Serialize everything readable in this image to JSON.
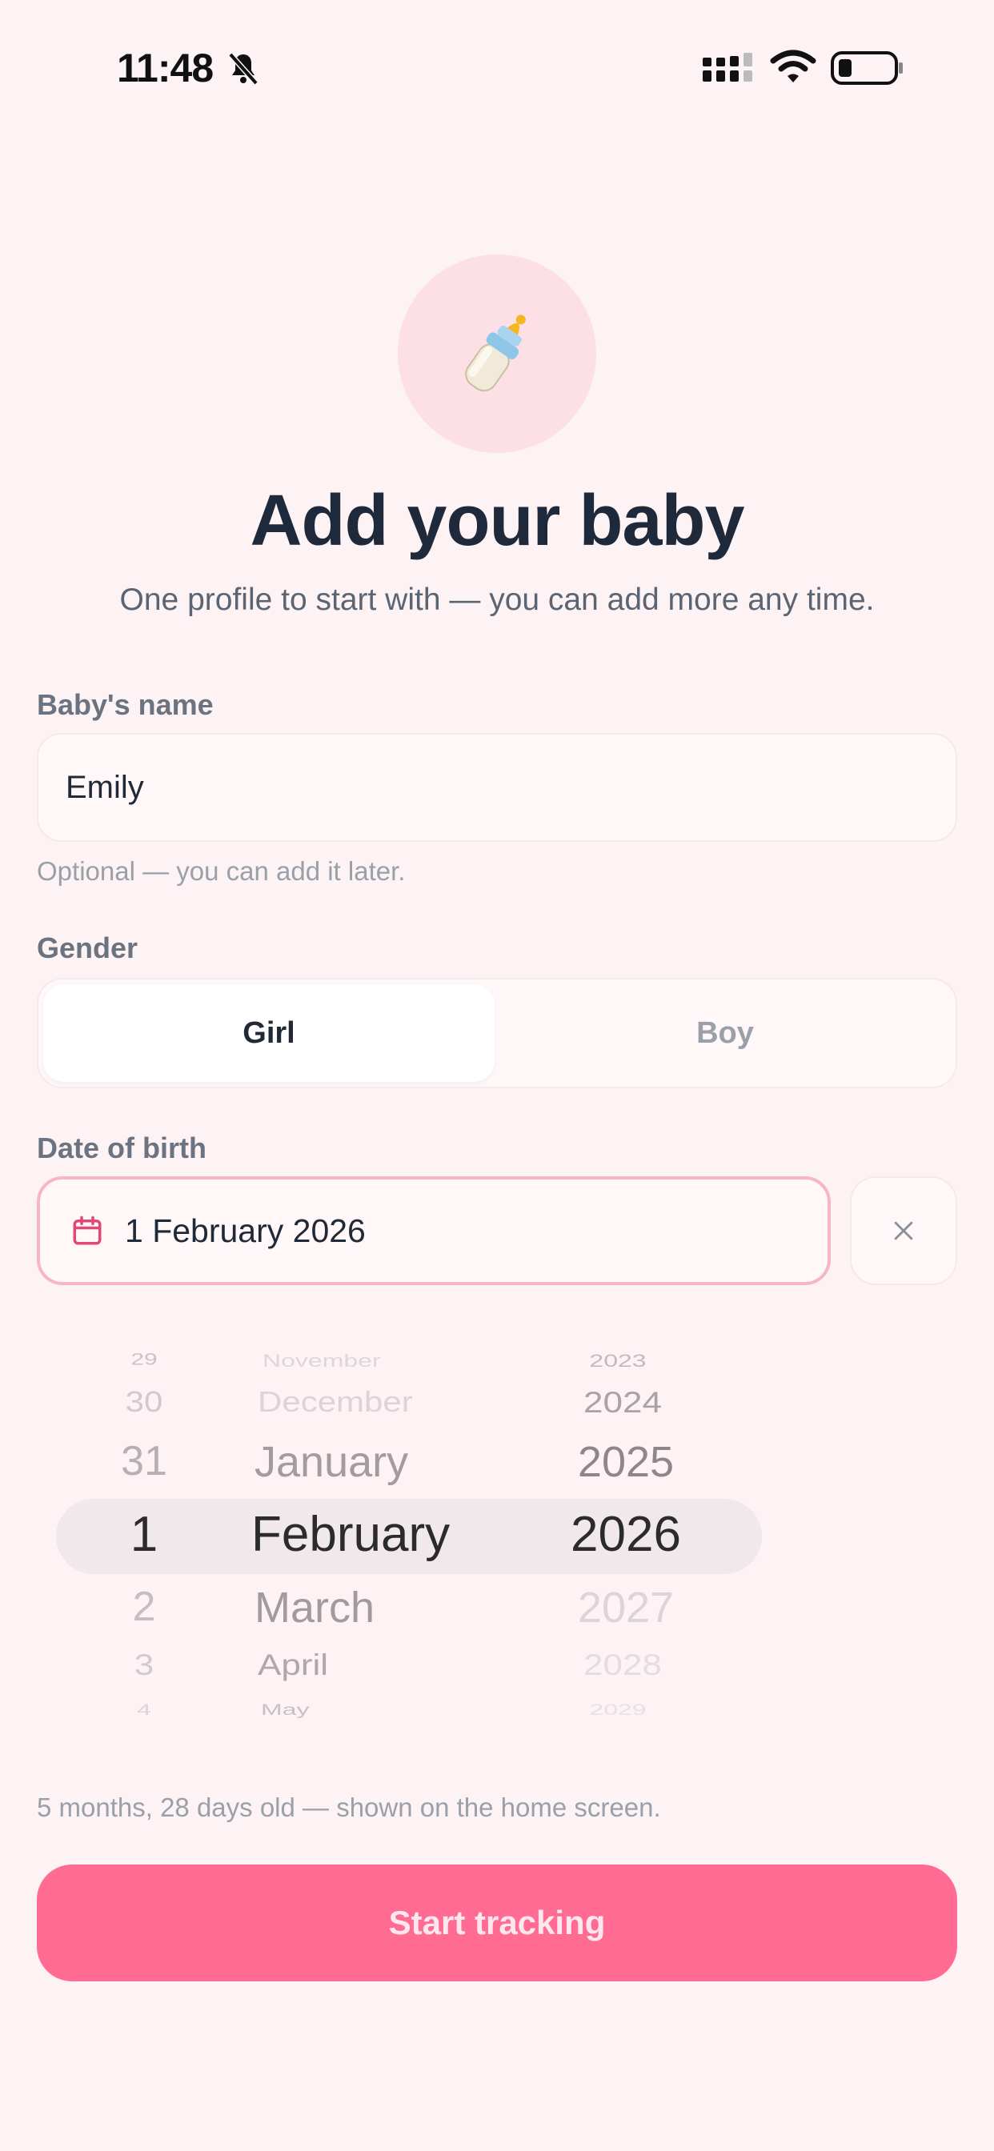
{
  "status_bar": {
    "time": "11:48"
  },
  "header": {
    "icon": "baby-bottle-icon",
    "title": "Add your baby",
    "subtitle": "One profile to start with — you can add more any time."
  },
  "name_field": {
    "label": "Baby's name",
    "value": "Emily",
    "hint": "Optional — you can add it later."
  },
  "gender": {
    "label": "Gender",
    "options": [
      "Girl",
      "Boy"
    ],
    "selected": "Girl"
  },
  "dob": {
    "label": "Date of birth",
    "value": "1 February 2026",
    "icon": "calendar-icon",
    "clear_icon": "close-icon"
  },
  "picker": {
    "rows": [
      {
        "day": "29",
        "month": "November",
        "year": "2023"
      },
      {
        "day": "30",
        "month": "December",
        "year": "2024"
      },
      {
        "day": "31",
        "month": "January",
        "year": "2025"
      },
      {
        "day": "1",
        "month": "February",
        "year": "2026"
      },
      {
        "day": "2",
        "month": "March",
        "year": "2027"
      },
      {
        "day": "3",
        "month": "April",
        "year": "2028"
      },
      {
        "day": "4",
        "month": "May",
        "year": "2029"
      }
    ]
  },
  "age_text": "5 months, 28 days old — shown on the home screen.",
  "start_button": "Start tracking",
  "colors": {
    "accent": "#ff6b93",
    "background": "#fdf3f4",
    "avatar_bg": "#fde0e6",
    "title": "#1e2a3b"
  }
}
